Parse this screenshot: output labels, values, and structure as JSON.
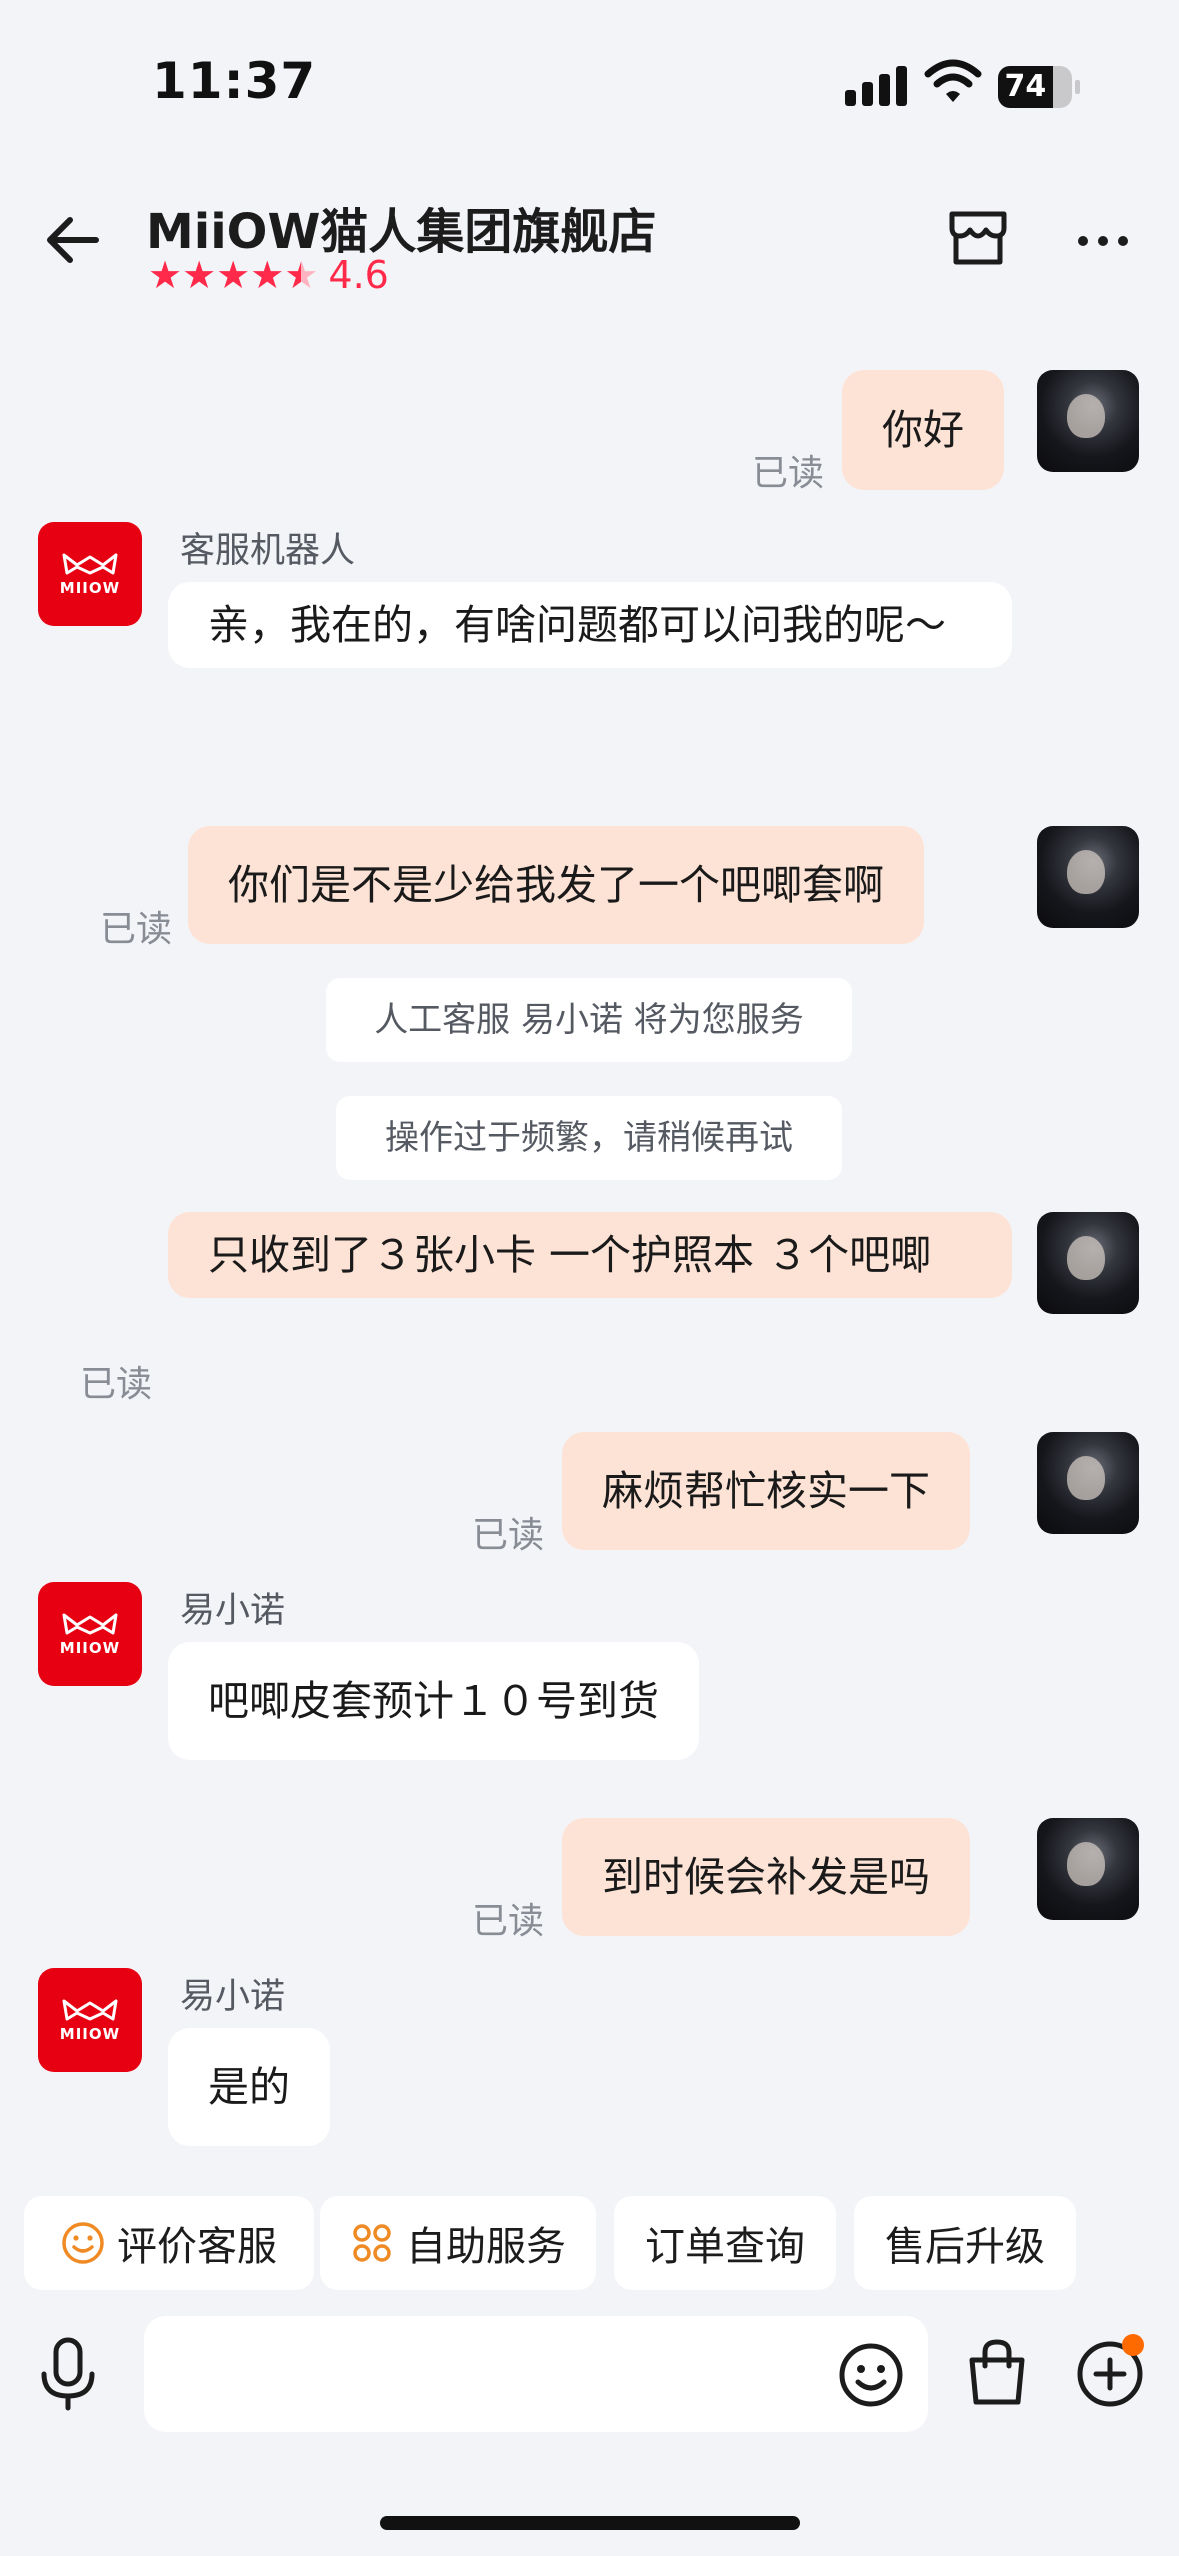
{
  "status_bar": {
    "time": "11:37",
    "battery": "74"
  },
  "header": {
    "title": "MiiOW猫人集团旗舰店",
    "rating": "4.6",
    "stars": 4.5
  },
  "brand": {
    "logo_text": "MIIOW",
    "accent": "#e60012",
    "star_color": "#ff2a4a"
  },
  "messages": [
    {
      "side": "out",
      "text": "你好",
      "read": "已读"
    },
    {
      "side": "in",
      "sender": "客服机器人",
      "text": "亲，我在的，有啥问题都可以问我的呢～"
    },
    {
      "side": "out",
      "text": "你们是不是少给我发了一个吧唧套啊",
      "read": "已读"
    },
    {
      "side": "system",
      "text": "人工客服 易小诺 将为您服务"
    },
    {
      "side": "system",
      "text": "操作过于频繁，请稍候再试"
    },
    {
      "side": "out",
      "text": "只收到了３张小卡  一个护照本  ３个吧唧",
      "read": "已读"
    },
    {
      "side": "out",
      "text": "麻烦帮忙核实一下",
      "read": "已读"
    },
    {
      "side": "in",
      "sender": "易小诺",
      "text": "吧唧皮套预计１０号到货"
    },
    {
      "side": "out",
      "text": "到时候会补发是吗",
      "read": "已读"
    },
    {
      "side": "in",
      "sender": "易小诺",
      "text": "是的"
    }
  ],
  "quick_actions": [
    {
      "label": "评价客服",
      "icon": "smile-icon"
    },
    {
      "label": "自助服务",
      "icon": "grid-icon"
    },
    {
      "label": "订单查询"
    },
    {
      "label": "售后升级"
    }
  ],
  "bottom_bar": {
    "icons": [
      "microphone-icon",
      "emoji-icon",
      "shopping-bag-icon",
      "plus-icon"
    ],
    "notification_color": "#ff6a00"
  }
}
